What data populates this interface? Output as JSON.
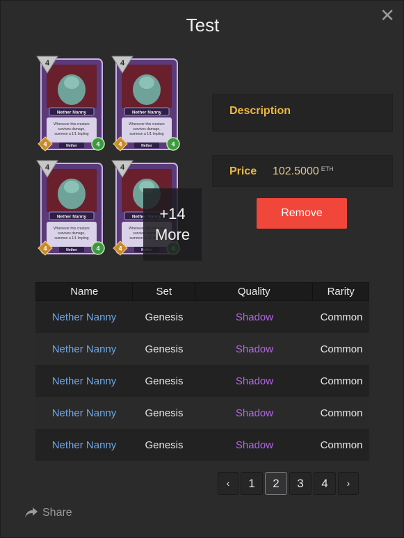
{
  "modal": {
    "title": "Test",
    "close_icon": "close-icon",
    "more_count": "+14",
    "more_label": "More"
  },
  "card": {
    "name": "Nether Nanny",
    "text_line1": "Whenever this creature",
    "text_line2": "survives damage,",
    "text_line3": "summon a 1/1 Impling",
    "cost": "4",
    "attack": "4",
    "health": "4",
    "god": "Nether"
  },
  "description": {
    "label": "Description"
  },
  "price": {
    "label": "Price",
    "value": "102.5000",
    "unit": "ETH"
  },
  "actions": {
    "remove_label": "Remove"
  },
  "table": {
    "headers": [
      "Name",
      "Set",
      "Quality",
      "Rarity"
    ],
    "rows": [
      [
        "Nether Nanny",
        "Genesis",
        "Shadow",
        "Common"
      ],
      [
        "Nether Nanny",
        "Genesis",
        "Shadow",
        "Common"
      ],
      [
        "Nether Nanny",
        "Genesis",
        "Shadow",
        "Common"
      ],
      [
        "Nether Nanny",
        "Genesis",
        "Shadow",
        "Common"
      ],
      [
        "Nether Nanny",
        "Genesis",
        "Shadow",
        "Common"
      ]
    ]
  },
  "pagination": {
    "prev": "‹",
    "pages": [
      "1",
      "2",
      "3",
      "4"
    ],
    "current": "2",
    "next": "›"
  },
  "share": {
    "label": "Share",
    "icon": "share-icon"
  },
  "colors": {
    "accent": "#f0473a",
    "label_gold": "#f0b73c",
    "name_blue": "#6fa7e6",
    "quality_purple": "#b267e6"
  }
}
